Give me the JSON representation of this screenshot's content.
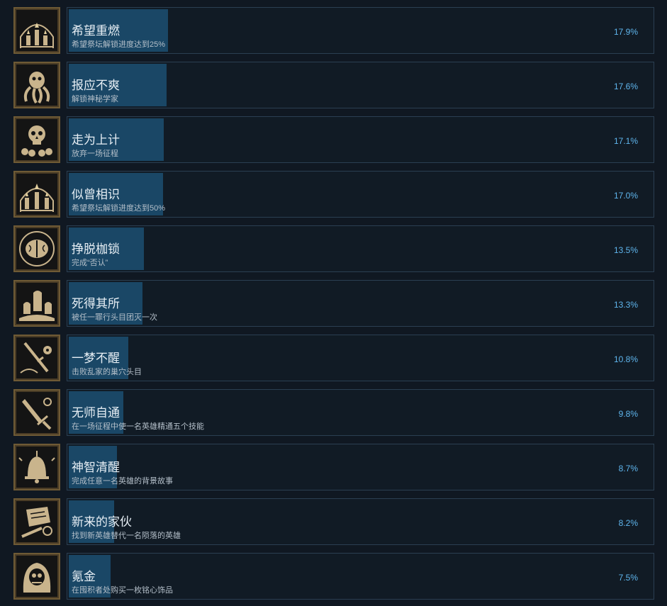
{
  "achievements": [
    {
      "title": "希望重燃",
      "desc": "希望祭坛解锁进度达到25%",
      "pct": "17.9%",
      "fraction": 0.179,
      "icon": "candle-shrine-icon"
    },
    {
      "title": "报应不爽",
      "desc": "解锁神秘学家",
      "pct": "17.6%",
      "fraction": 0.176,
      "icon": "tentacle-horror-icon"
    },
    {
      "title": "走为上计",
      "desc": "放弃一场征程",
      "pct": "17.1%",
      "fraction": 0.171,
      "icon": "skull-pile-icon"
    },
    {
      "title": "似曾相识",
      "desc": "希望祭坛解锁进度达到50%",
      "pct": "17.0%",
      "fraction": 0.17,
      "icon": "candle-shrine-icon"
    },
    {
      "title": "挣脱枷锁",
      "desc": "完成“否认”",
      "pct": "13.5%",
      "fraction": 0.135,
      "icon": "brain-icon"
    },
    {
      "title": "死得其所",
      "desc": "被任一罪行头目团灭一次",
      "pct": "13.3%",
      "fraction": 0.133,
      "icon": "graveyard-icon"
    },
    {
      "title": "一梦不醒",
      "desc": "击败乱家的巢穴头目",
      "pct": "10.8%",
      "fraction": 0.108,
      "icon": "sword-flower-icon"
    },
    {
      "title": "无师自通",
      "desc": "在一场征程中使一名英雄精通五个技能",
      "pct": "9.8%",
      "fraction": 0.098,
      "icon": "dagger-icon"
    },
    {
      "title": "神智清醒",
      "desc": "完成任意一名英雄的背景故事",
      "pct": "8.7%",
      "fraction": 0.087,
      "icon": "bell-icon"
    },
    {
      "title": "新来的家伙",
      "desc": "找到新英雄替代一名陨落的英雄",
      "pct": "8.2%",
      "fraction": 0.082,
      "icon": "book-sword-icon"
    },
    {
      "title": "氪金",
      "desc": "在囤积者处购买一枚铭心饰品",
      "pct": "7.5%",
      "fraction": 0.075,
      "icon": "hooded-skull-icon"
    }
  ],
  "colors": {
    "background": "#101822",
    "bar_fill": "#1a4766",
    "bar_border": "#2b3f52",
    "percent_text": "#5fb6ee",
    "icon_frame": "#4a3c26",
    "icon_art": "#c9b48c"
  }
}
